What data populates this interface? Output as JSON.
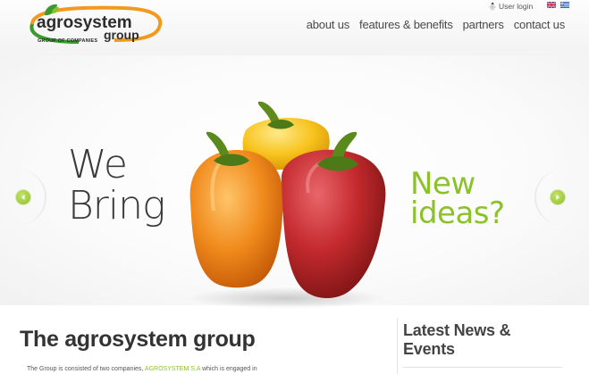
{
  "header": {
    "logo": {
      "word1": "agrosystem",
      "word2": "group",
      "tagline": "GROUP OF COMPANIES"
    },
    "user_login": "User login",
    "languages": [
      "English",
      "Greek"
    ],
    "nav": {
      "items": [
        {
          "label": "about us"
        },
        {
          "label": "features & benefits"
        },
        {
          "label": "partners"
        },
        {
          "label": "contact us"
        }
      ]
    }
  },
  "hero": {
    "left_line1": "We",
    "left_line2": "Bring",
    "right_line1": "New",
    "right_line2": "ideas?",
    "prev_icon": "chevron-left-icon",
    "next_icon": "chevron-right-icon"
  },
  "content": {
    "title": "The agrosystem group",
    "intro_before": "The Group is consisted of two companies, ",
    "intro_link": "AGROSYSTEM S.A",
    "intro_after": " which is engaged in"
  },
  "sidebar": {
    "news_title": "Latest News & Events"
  },
  "colors": {
    "accent_green": "#8bc22a",
    "logo_orange": "#f39a1e",
    "logo_green": "#3a9a2e",
    "text_dark": "#3a3a3a"
  }
}
